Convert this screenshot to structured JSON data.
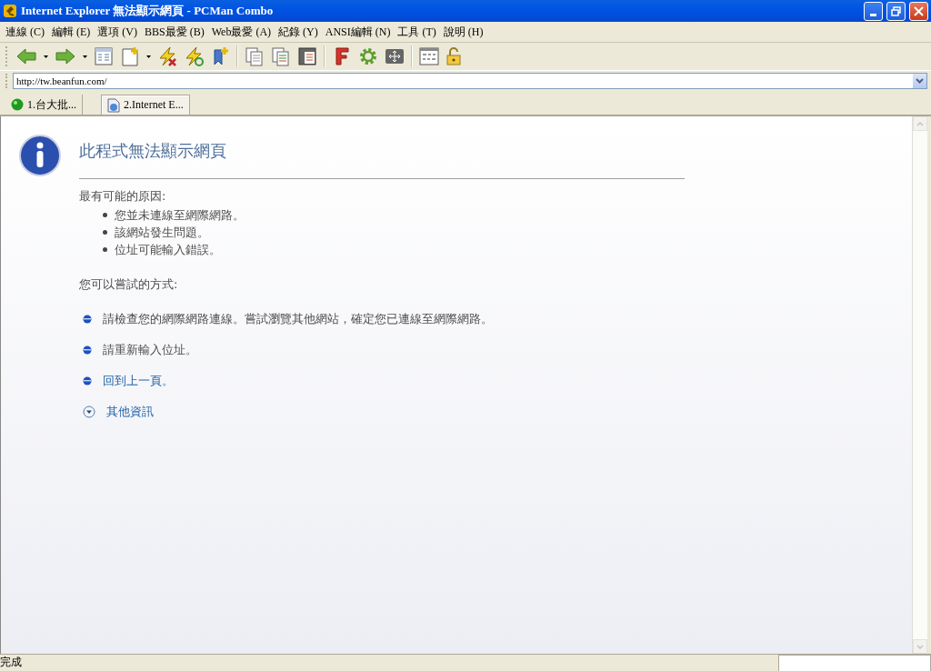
{
  "window": {
    "title": "Internet Explorer 無法顯示網頁 - PCMan Combo"
  },
  "menu": [
    {
      "label": "連線 (C)"
    },
    {
      "label": "編輯 (E)"
    },
    {
      "label": "選項 (V)"
    },
    {
      "label": "BBS最愛 (B)"
    },
    {
      "label": "Web最愛 (A)"
    },
    {
      "label": "紀錄 (Y)"
    },
    {
      "label": "ANSI編輯 (N)"
    },
    {
      "label": "工具 (T)"
    },
    {
      "label": "說明 (H)"
    }
  ],
  "address": {
    "value": "http://tw.beanfun.com/"
  },
  "tabs": [
    {
      "label": "1.台大批...",
      "selected": false,
      "kind": "bbs"
    },
    {
      "label": "2.Internet E...",
      "selected": true,
      "kind": "web"
    }
  ],
  "page": {
    "heading": "此程式無法顯示網頁",
    "causes_label": "最有可能的原因:",
    "causes": [
      "您並未連線至網際網路。",
      "該網站發生問題。",
      "位址可能輸入錯誤。"
    ],
    "try_label": "您可以嘗試的方式:",
    "suggestions": [
      {
        "text": "請檢查您的網際網路連線。嘗試瀏覽其他網站，確定您已連線至網際網路。",
        "kind": "text"
      },
      {
        "text": "請重新輸入位址。",
        "kind": "text"
      },
      {
        "text": "回到上一頁。",
        "kind": "link"
      },
      {
        "text": "其他資訊",
        "kind": "expand"
      }
    ]
  },
  "status_bar": {
    "text": "完成"
  }
}
